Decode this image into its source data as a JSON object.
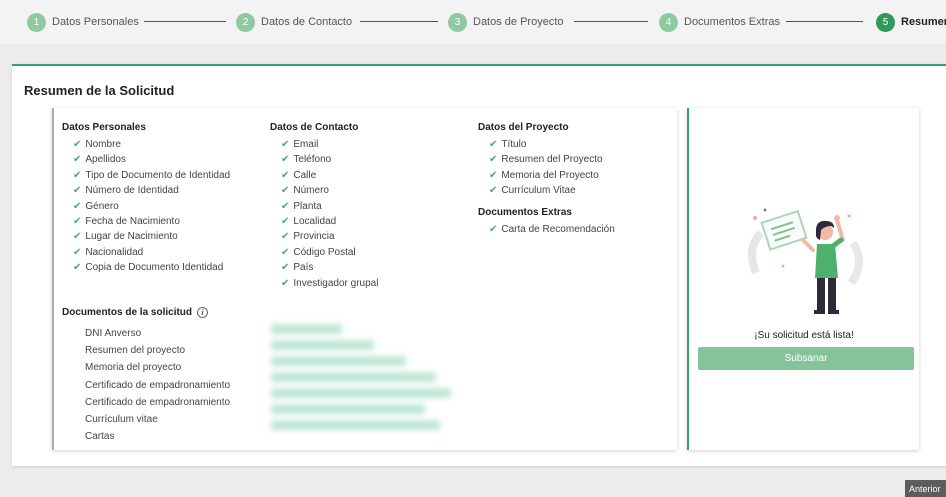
{
  "stepper": {
    "steps": [
      {
        "num": "1",
        "label": "Datos Personales"
      },
      {
        "num": "2",
        "label": "Datos de Contacto"
      },
      {
        "num": "3",
        "label": "Datos de Proyecto"
      },
      {
        "num": "4",
        "label": "Documentos Extras"
      },
      {
        "num": "5",
        "label": "Resumen"
      }
    ],
    "active_step": 5
  },
  "main": {
    "title": "Resumen de la Solicitud"
  },
  "personales": {
    "title": "Datos Personales",
    "items": [
      "Nombre",
      "Apellidos",
      "Tipo de Documento de Identidad",
      "Número de Identidad",
      "Género",
      "Fecha de Nacimiento",
      "Lugar de Nacimiento",
      "Nacionalidad",
      "Copia de Documento Identidad"
    ]
  },
  "contacto": {
    "title": "Datos de Contacto",
    "items": [
      "Email",
      "Teléfono",
      "Calle",
      "Número",
      "Planta",
      "Localidad",
      "Provincia",
      "Código Postal",
      "País",
      "Investigador grupal"
    ]
  },
  "proyecto": {
    "title": "Datos del Proyecto",
    "items": [
      "Título",
      "Resumen del Proyecto",
      "Memoria del Proyecto",
      "Currículum Vitae"
    ]
  },
  "extras": {
    "title": "Documentos Extras",
    "items": [
      "Carta de Recomendación"
    ]
  },
  "documentos": {
    "title": "Documentos de la solicitud",
    "items": [
      "DNI Anverso",
      "Resumen del proyecto",
      "Memoria del proyecto",
      "Certificado de empadronamiento",
      "Certificado de empadronamiento",
      "Currículum vitae",
      "Cartas"
    ]
  },
  "side": {
    "ready_text": "¡Su solicitud está lista!",
    "button_label": "Subsanar"
  },
  "footer": {
    "prev_label": "Anterior"
  },
  "colors": {
    "accent": "#33a46a",
    "step_inactive": "#8ec99f",
    "button": "#85c49b",
    "check": "#4aa867"
  },
  "icons": {
    "check": "check-icon",
    "info": "info-icon"
  }
}
